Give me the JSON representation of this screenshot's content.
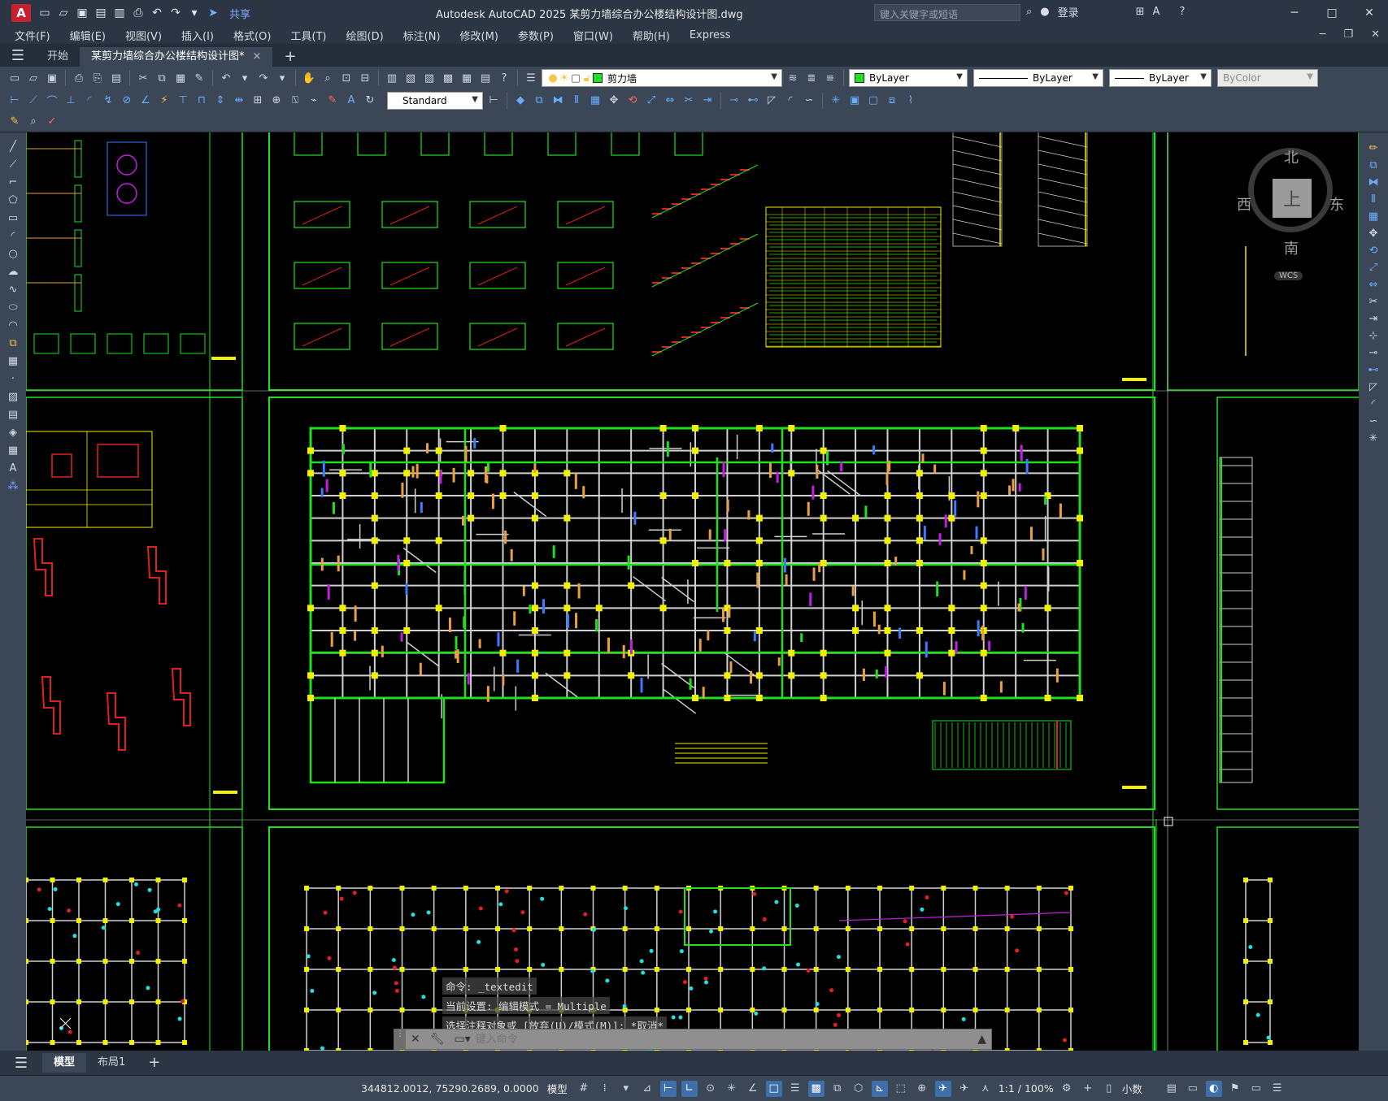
{
  "app": {
    "logo_letter": "A",
    "share_label": "共享",
    "window_title": "Autodesk AutoCAD 2025    某剪力墙综合办公楼结构设计图.dwg",
    "search_placeholder": "键入关键字或短语",
    "login_label": "登录"
  },
  "menu": [
    "文件(F)",
    "编辑(E)",
    "视图(V)",
    "插入(I)",
    "格式(O)",
    "工具(T)",
    "绘图(D)",
    "标注(N)",
    "修改(M)",
    "参数(P)",
    "窗口(W)",
    "帮助(H)",
    "Express"
  ],
  "tabs": {
    "start": "开始",
    "document": "某剪力墙综合办公楼结构设计图*",
    "close_symbol": "×",
    "add_symbol": "+"
  },
  "toolbar": {
    "layer_name": "剪力墙",
    "layer_color": "#22e022",
    "color_value": "ByLayer",
    "linetype_value": "ByLayer",
    "lineweight_value": "ByLayer",
    "plotstyle_value": "ByColor",
    "text_style": "Standard"
  },
  "viewcube": {
    "north": "北",
    "south": "南",
    "east": "东",
    "west": "西",
    "top": "上",
    "wcs": "WCS"
  },
  "command": {
    "history": [
      "命令: _textedit",
      "当前设置: 编辑模式 = Multiple",
      "选择注释对象或 [放弃(U)/模式(M)]: *取消*"
    ],
    "placeholder": "键入命令"
  },
  "layout_tabs": [
    "模型",
    "布局1"
  ],
  "layout_add": "+",
  "status": {
    "coordinates": "344812.0012, 75290.2689, 0.0000",
    "space": "模型",
    "scale": "1:1 / 100%",
    "units": "小数"
  },
  "colors": {
    "drawing_green": "#20e020",
    "drawing_yellow": "#f0f000",
    "drawing_red": "#e02020",
    "drawing_white": "#d0d0d0",
    "drawing_blue": "#3a7bff",
    "drawing_magenta": "#c020e0",
    "drawing_orange": "#e8a040"
  }
}
